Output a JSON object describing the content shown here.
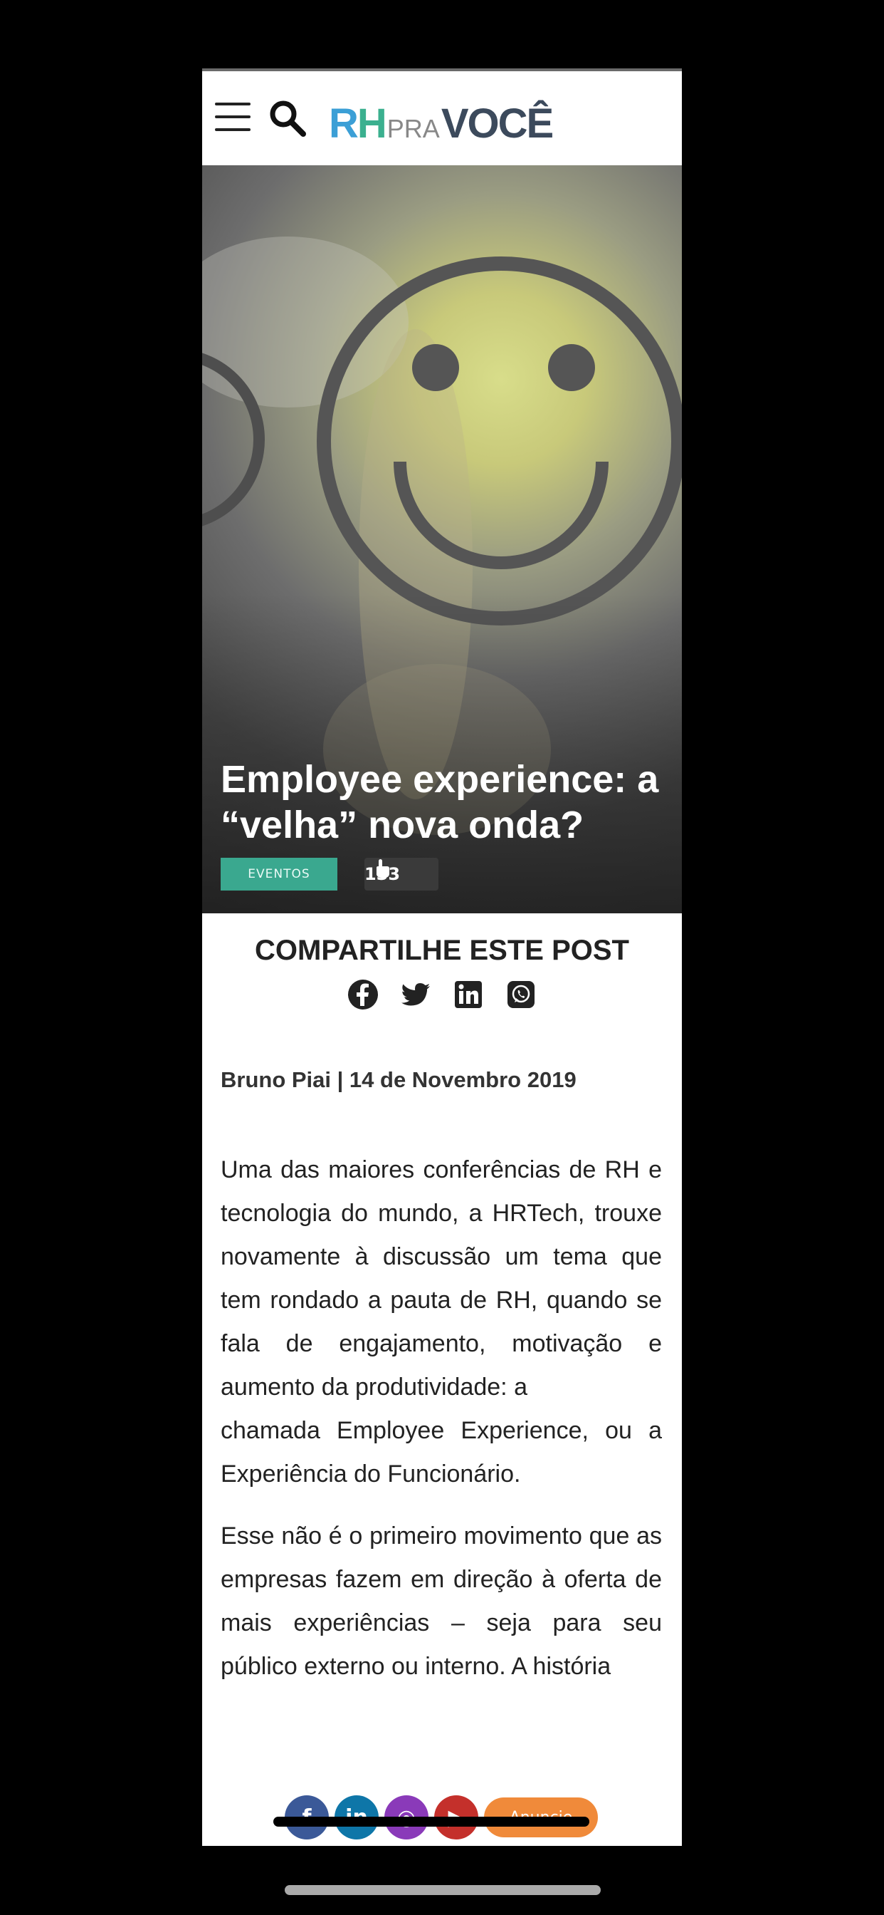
{
  "header": {
    "logo": {
      "rh_r": "R",
      "rh_h": "H",
      "pra": "PRA",
      "voce": "VOCÊ"
    }
  },
  "hero": {
    "title": "Employee experience: a\n“velha” nova onda?",
    "category": "EVENTOS",
    "views": "133"
  },
  "share": {
    "title": "COMPARTILHE ESTE POST",
    "icons": [
      "facebook-icon",
      "twitter-icon",
      "linkedin-icon",
      "whatsapp-icon"
    ]
  },
  "byline": "Bruno Piai | 14 de Novembro 2019",
  "article": {
    "p1a": "Uma das maiores conferências de RH e tecnologia do mundo, a HRTech, trouxe novamente à discussão um tema que tem rondado a pauta de RH, quando se fala de engajamento, motivação e aumento da produtividade: a",
    "p1b": "chamada Employee Experience, ou a Experiência do Funcionário.",
    "p2": "Esse não é o primeiro movimento que as empresas fazem em direção à oferta de mais experiências – seja para seu público externo ou interno.  A história"
  },
  "float_bar": {
    "facebook": "f",
    "linkedin": "in",
    "instagram": "◎",
    "youtube": "▶",
    "anuncie": "Anuncie"
  },
  "colors": {
    "accent_green": "#3aa88f",
    "logo_blue": "#3b9fd6",
    "anuncie_orange": "#f08a3a"
  }
}
